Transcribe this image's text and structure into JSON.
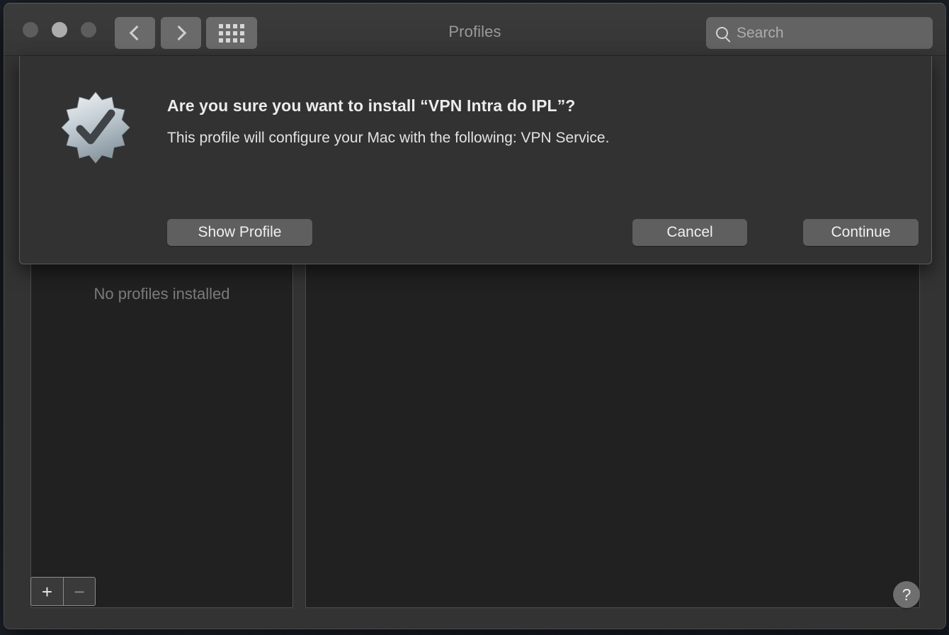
{
  "window": {
    "title": "Profiles",
    "traffic_lights": [
      "close",
      "minimize",
      "zoom"
    ]
  },
  "toolbar": {
    "back_icon": "chevron-left-icon",
    "forward_icon": "chevron-right-icon",
    "show_all_icon": "grid-dots-icon",
    "search": {
      "icon": "search-icon",
      "value": "",
      "placeholder": "Search"
    }
  },
  "prefs": {
    "sidebar_empty_label": "No profiles installed",
    "add_label": "+",
    "remove_label": "−",
    "help_label": "?"
  },
  "sheet": {
    "icon": "profile-badge-check-icon",
    "title": "Are you sure you want to install “VPN Intra do IPL”?",
    "message": "This profile will configure your Mac with the following: VPN Service.",
    "buttons": {
      "show_profile": "Show Profile",
      "cancel": "Cancel",
      "continue": "Continue"
    }
  },
  "colors": {
    "window_bg": "#333333",
    "panel_bg": "#212121",
    "sheet_bg": "#323232",
    "button_bg": "#5f5f5f",
    "text_primary": "#ececec",
    "text_secondary": "#9a9a9a"
  }
}
